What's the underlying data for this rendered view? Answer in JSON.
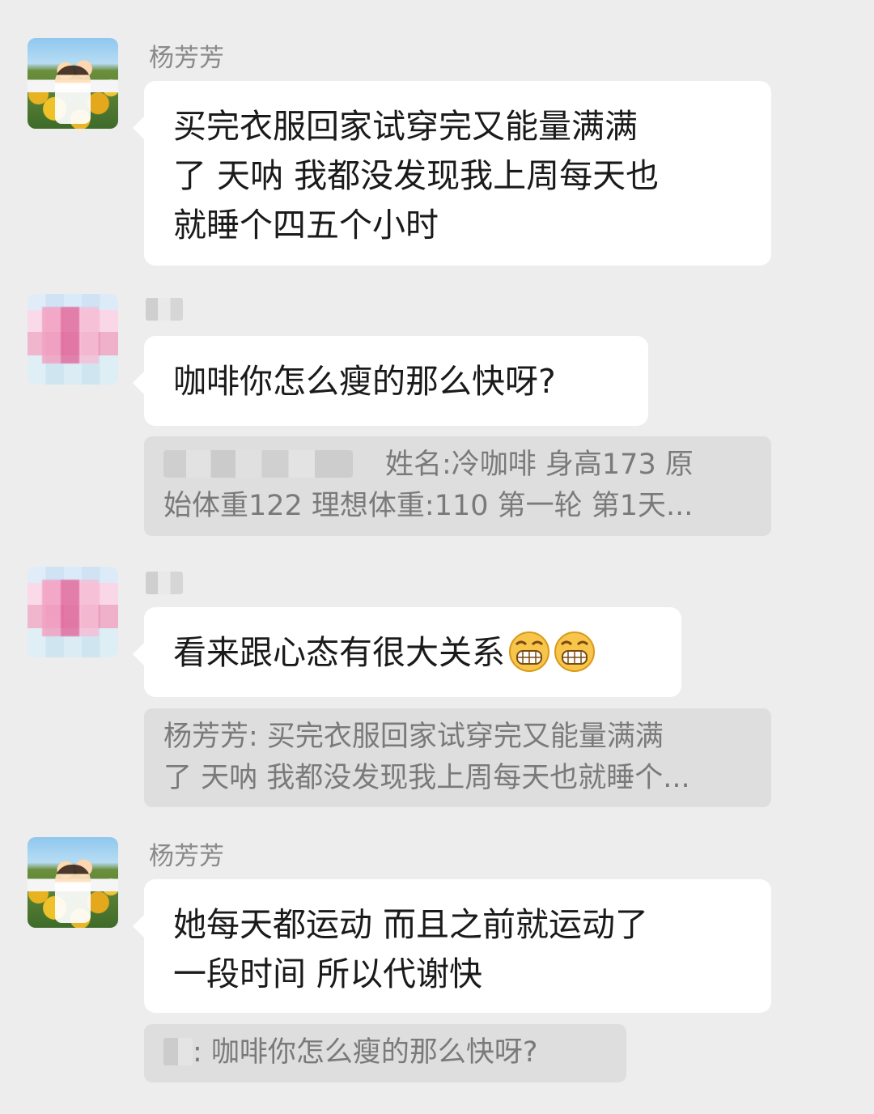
{
  "messages": [
    {
      "sender": "杨芳芳",
      "text_lines": [
        "买完衣服回家试穿完又能量满满",
        "了 天呐 我都没发现我上周每天也",
        "就睡个四五个小时"
      ]
    },
    {
      "sender": "",
      "text": "咖啡你怎么瘦的那么快呀?",
      "quote_lines": [
        "姓名:冷咖啡 身高173  原",
        "始体重122 理想体重:110 第一轮 第1天..."
      ]
    },
    {
      "sender": "",
      "text": "看来跟心态有很大关系",
      "emoji": [
        "grin-emoji",
        "grin-emoji"
      ],
      "quote_lines": [
        "杨芳芳:  买完衣服回家试穿完又能量满满",
        "了 天呐 我都没发现我上周每天也就睡个..."
      ]
    },
    {
      "sender": "杨芳芳",
      "text_lines": [
        "她每天都运动 而且之前就运动了",
        "一段时间 所以代谢快"
      ],
      "quote_text": ":  咖啡你怎么瘦的那么快呀?"
    }
  ]
}
